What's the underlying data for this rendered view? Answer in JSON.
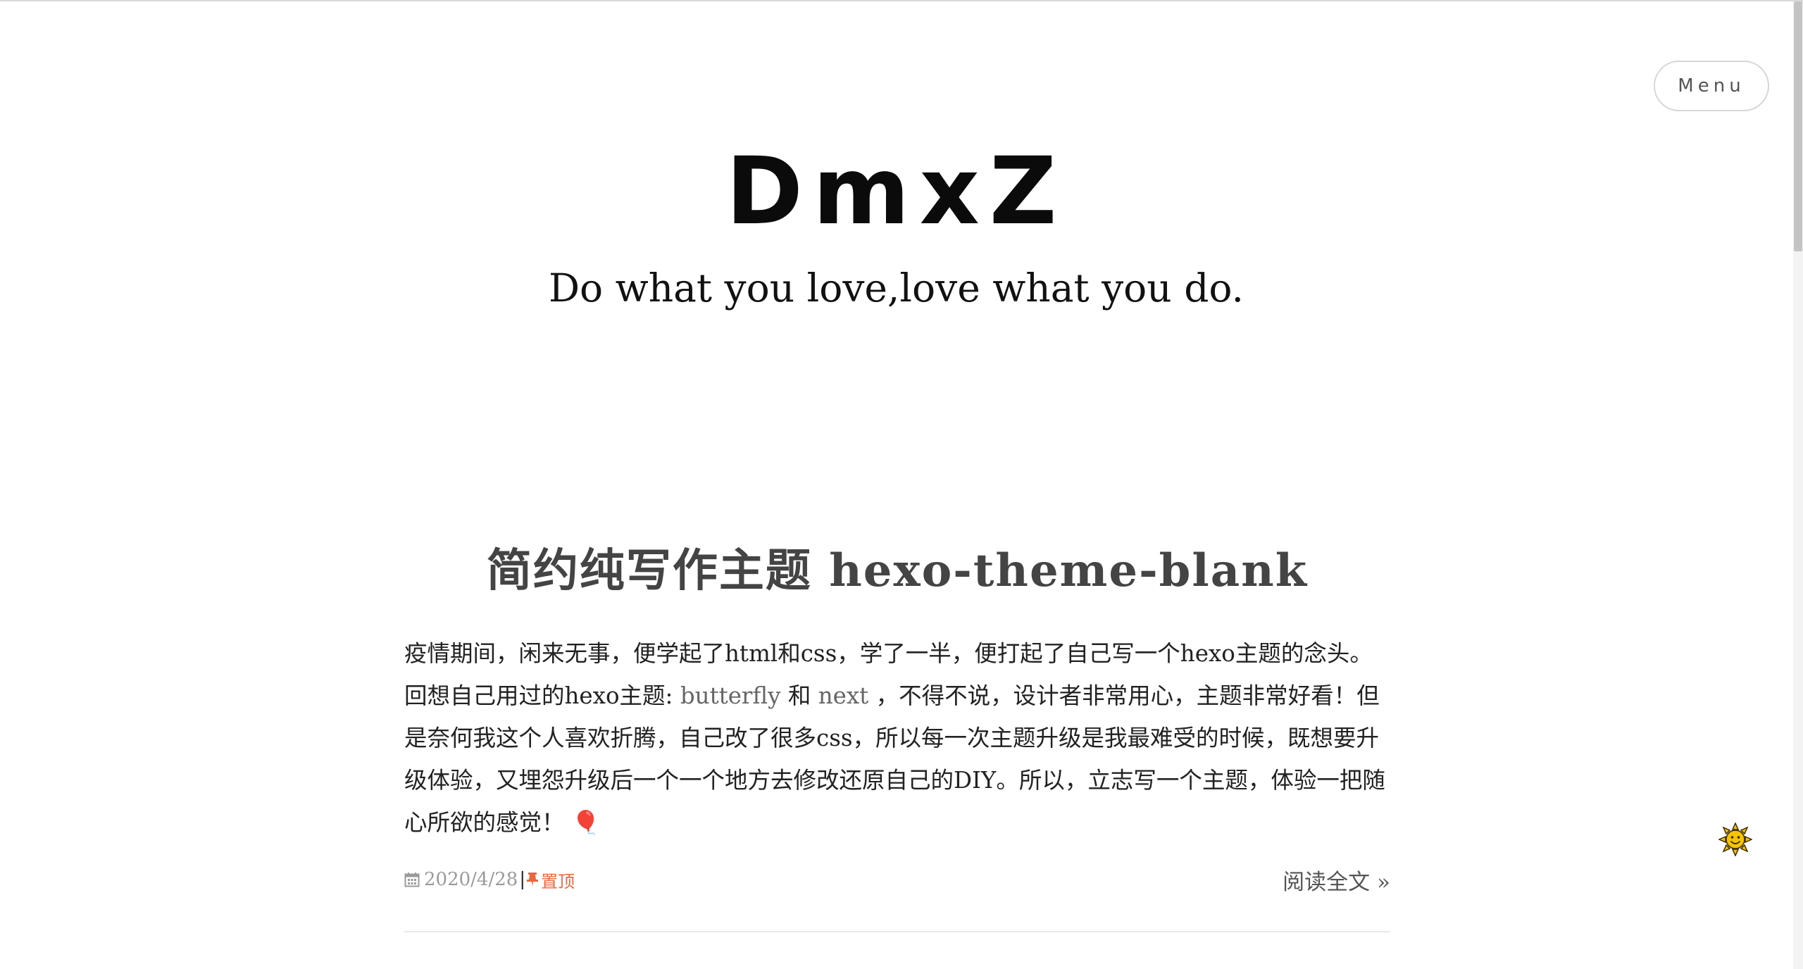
{
  "header": {
    "menu_label": "Menu",
    "site_title": "DmxZ",
    "site_subtitle": "Do what you love,love what you do."
  },
  "post": {
    "title": "简约纯写作主题 hexo-theme-blank",
    "excerpt": {
      "part1": "疫情期间，闲来无事，便学起了html和css，学了一半，便打起了自己写一个hexo主题的念头。回想自己用过的hexo主题: ",
      "link1": "butterfly",
      "part2": " 和 ",
      "link2": "next",
      "part3": " ，不得不说，设计者非常用心，主题非常好看！但是奈何我这个人喜欢折腾，自己改了很多css，所以每一次主题升级是我最难受的时候，既想要升级体验，又埋怨升级后一个一个地方去修改还原自己的DIY。所以，立志写一个主题，体验一把随心所欲的感觉！",
      "emoji": "🎈"
    },
    "meta": {
      "date": "2020/4/28",
      "separator": "|",
      "pinned_label": "置顶",
      "read_more": "阅读全文 »"
    }
  },
  "colors": {
    "accent_pin": "#e8683e",
    "title": "#0b0b0b",
    "post_title": "#444444",
    "meta_gray": "#9a9a9a"
  },
  "icons": {
    "menu": "menu-button",
    "calendar": "calendar-icon",
    "pin": "pushpin-icon",
    "balloon": "balloon-emoji",
    "widget": "sun-face-icon"
  }
}
